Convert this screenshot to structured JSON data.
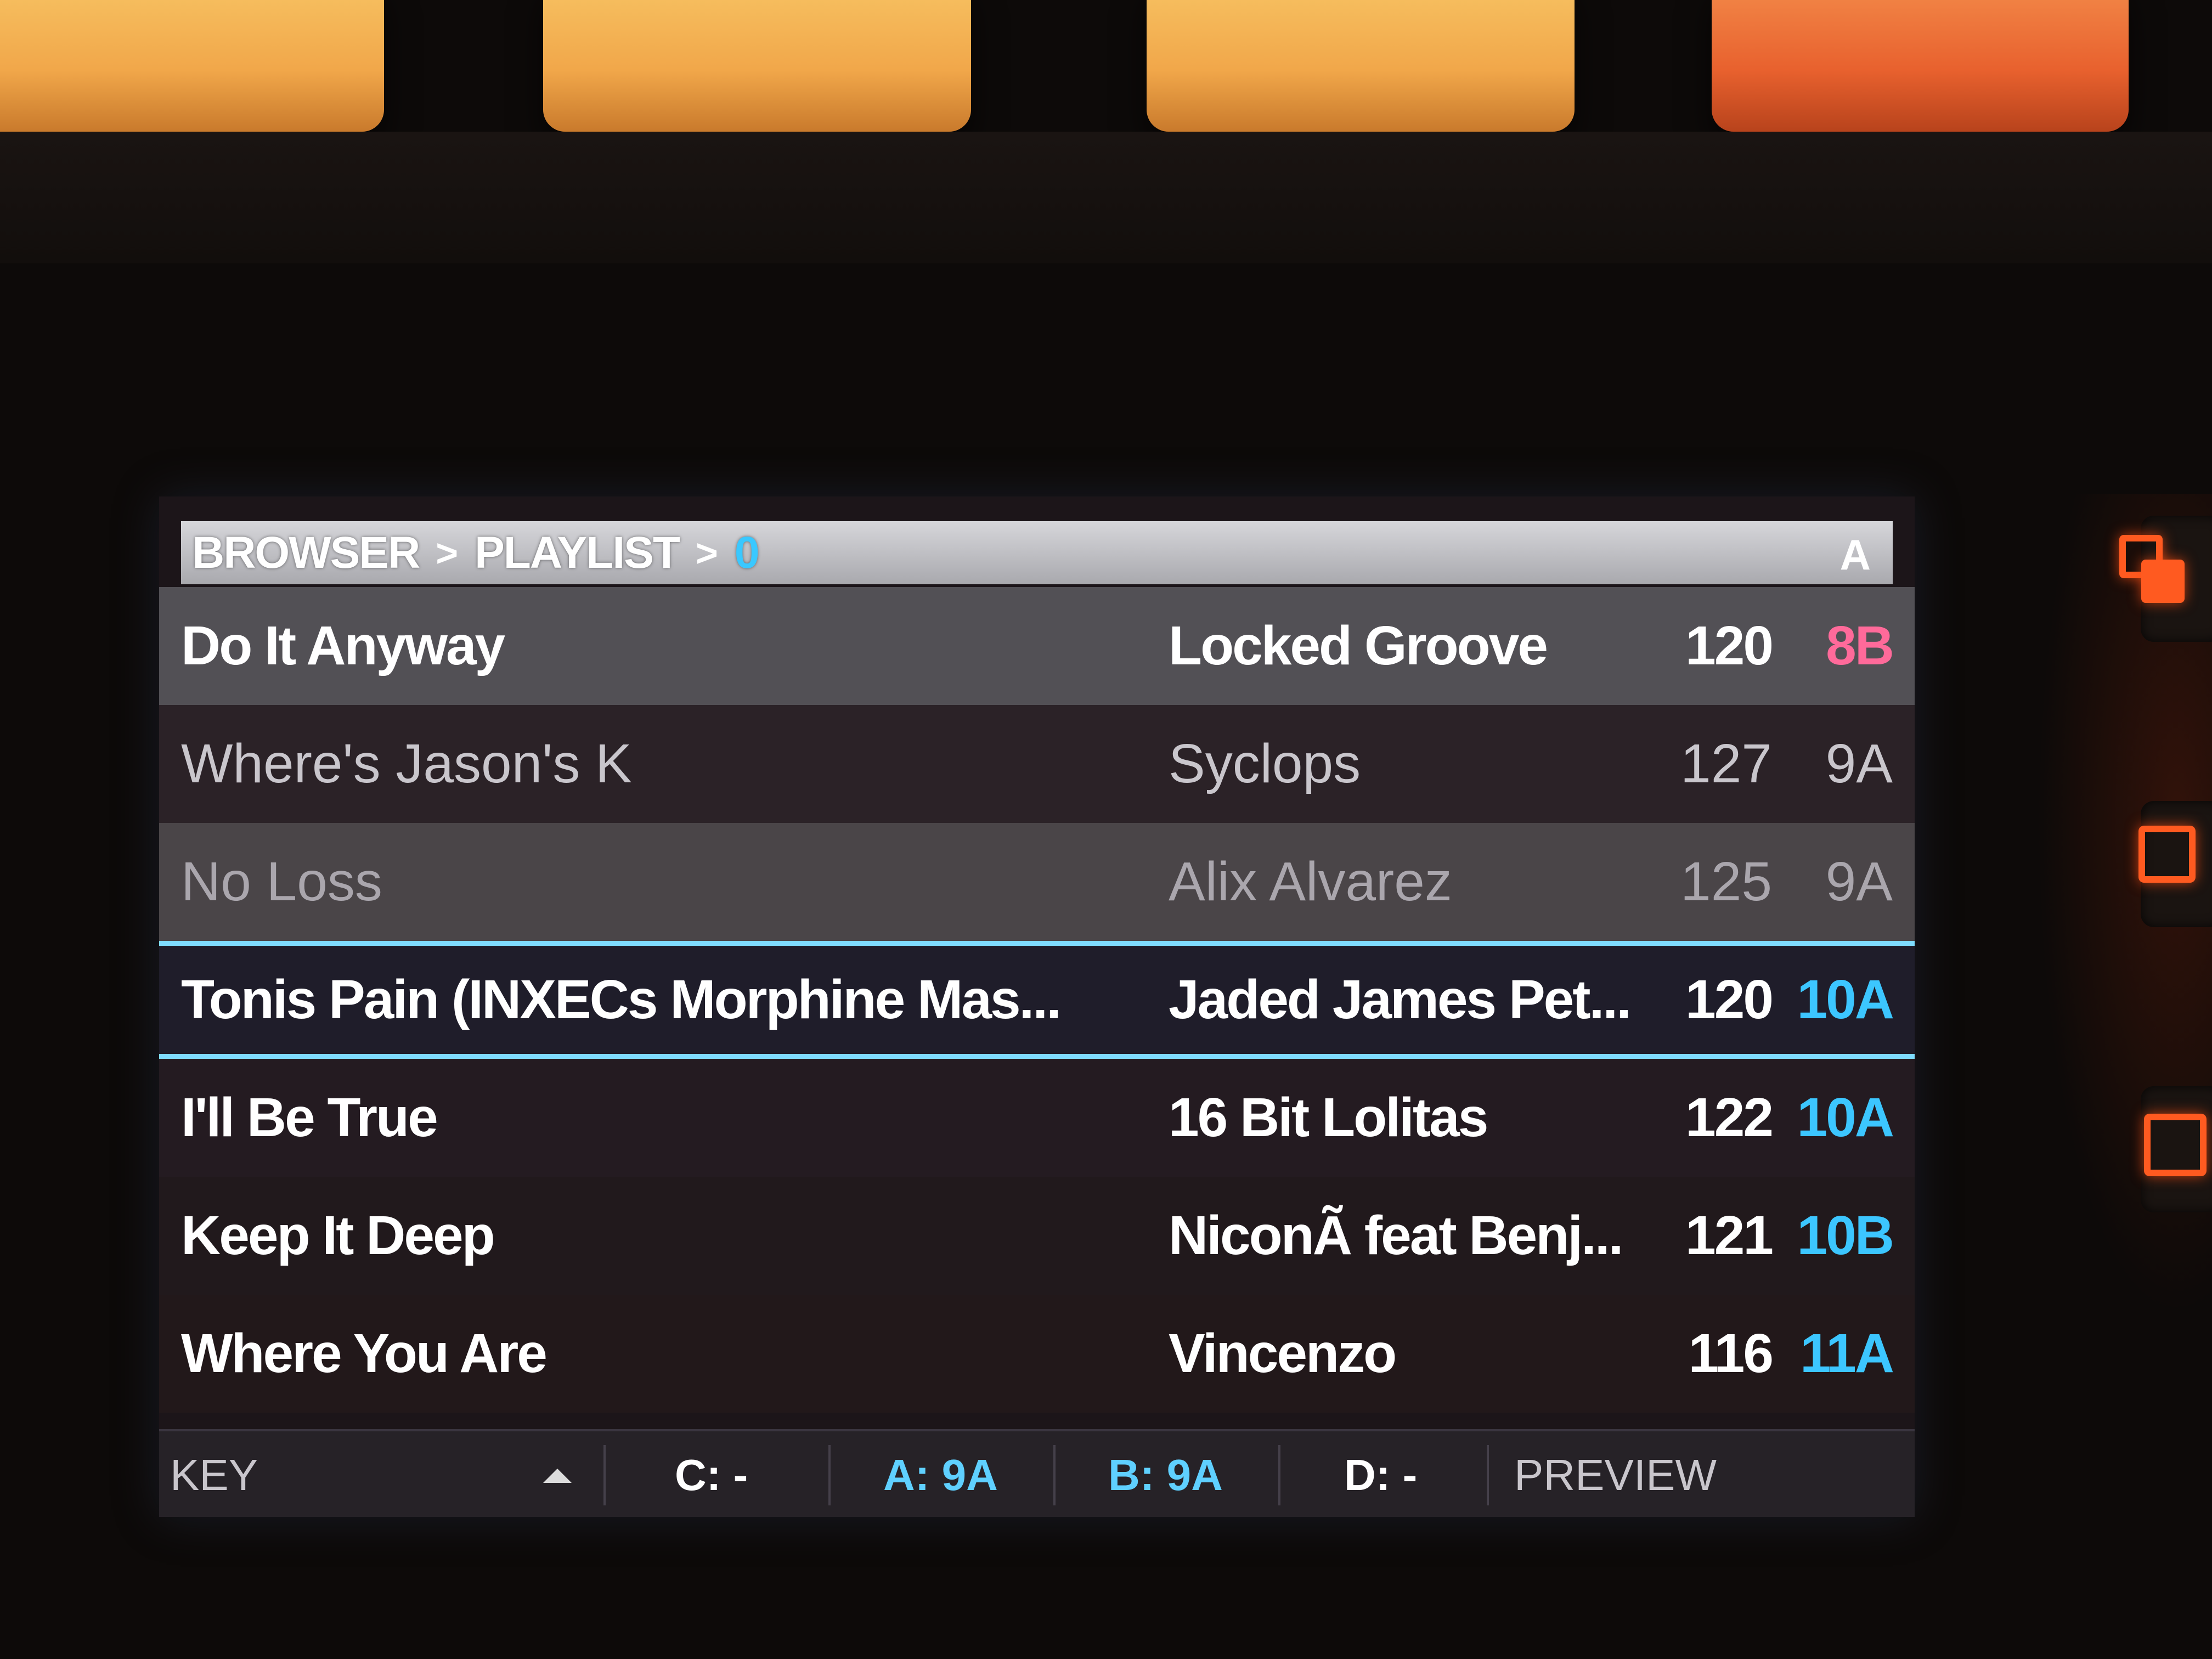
{
  "header": {
    "crumbs": [
      "BROWSER",
      "PLAYLIST",
      "0"
    ],
    "separator": ">",
    "deck": "A"
  },
  "tracks": [
    {
      "title": "Do It Anyway",
      "artist": "Locked Groove",
      "bpm": "120",
      "key": "8B"
    },
    {
      "title": "Where's Jason's K",
      "artist": "Syclops",
      "bpm": "127",
      "key": "9A"
    },
    {
      "title": "No Loss",
      "artist": "Alix Alvarez",
      "bpm": "125",
      "key": "9A"
    },
    {
      "title": "Tonis Pain (INXECs Morphine Mas...",
      "artist": "Jaded James Pet...",
      "bpm": "120",
      "key": "10A"
    },
    {
      "title": "I'll Be True",
      "artist": "16 Bit Lolitas",
      "bpm": "122",
      "key": "10A"
    },
    {
      "title": "Keep It Deep",
      "artist": "NiconÃ feat Benj...",
      "bpm": "121",
      "key": "10B"
    },
    {
      "title": "Where You Are",
      "artist": "Vincenzo",
      "bpm": "116",
      "key": "11A"
    }
  ],
  "footer": {
    "sort_label": "KEY",
    "deck_c": "C: -",
    "deck_a": "A: 9A",
    "deck_b": "B: 9A",
    "deck_d": "D: -",
    "preview_label": "PREVIEW"
  },
  "colors": {
    "key_harmonic": "#3cc6ff",
    "key_loaded": "#ff6a9a",
    "selection": "#7fdcff",
    "hardware_accent": "#ff5a20"
  },
  "icons": [
    "sort-ascending-icon",
    "duplicate-icon",
    "square-icon"
  ]
}
